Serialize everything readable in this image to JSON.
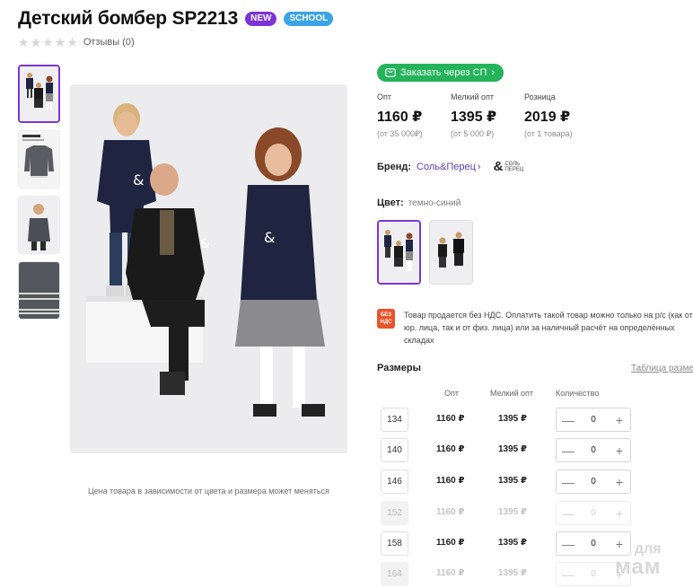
{
  "product": {
    "title": "Детский бомбер SP2213",
    "badges": [
      "NEW",
      "SCHOOL"
    ],
    "reviews": "Отзывы (0)"
  },
  "gallery": {
    "thumbs": [
      "group-photo",
      "bomber-label",
      "boy-photo",
      "sleeve-detail"
    ],
    "price_note": "Цена товара в зависимости от цвета и размера может меняться"
  },
  "order": {
    "button_label": "Заказать через СП",
    "button_color": "#24b35a"
  },
  "prices": {
    "opt": {
      "label": "Опт",
      "value": "1160 ₽",
      "cond": "(от 35 000₽)"
    },
    "small_opt": {
      "label": "Мелкий опт",
      "value": "1395 ₽",
      "cond": "(от 5 000 ₽)"
    },
    "retail": {
      "label": "Розница",
      "value": "2019 ₽",
      "cond": "(от 1 товара)"
    }
  },
  "brand": {
    "label": "Бренд:",
    "name": "Соль&Перец",
    "logo_top": "СОЛЬ",
    "logo_bottom": "ПЕРЕЦ"
  },
  "color": {
    "label": "Цвет:",
    "value": "темно-синий"
  },
  "vat": {
    "badge_top": "БЕЗ",
    "badge_bottom": "НДС",
    "text": "Товар продается без НДС. Оплатить такой товар можно только на р/с (как от юр. лица, так и от физ. лица) или за наличный расчёт на определённых складах"
  },
  "sizes": {
    "title": "Размеры",
    "table_link": "Таблица разме",
    "headers": {
      "opt": "Опт",
      "small_opt": "Мелкий опт",
      "quantity": "Количество"
    },
    "rows": [
      {
        "size": "134",
        "opt": "1160 ₽",
        "small": "1395 ₽",
        "qty": "0",
        "available": true
      },
      {
        "size": "140",
        "opt": "1160 ₽",
        "small": "1395 ₽",
        "qty": "0",
        "available": true
      },
      {
        "size": "146",
        "opt": "1160 ₽",
        "small": "1395 ₽",
        "qty": "0",
        "available": true
      },
      {
        "size": "152",
        "opt": "1160 ₽",
        "small": "1395 ₽",
        "qty": "0",
        "available": false
      },
      {
        "size": "158",
        "opt": "1160 ₽",
        "small": "1395 ₽",
        "qty": "0",
        "available": true
      },
      {
        "size": "164",
        "opt": "1160 ₽",
        "small": "1395 ₽",
        "qty": "0",
        "available": false
      }
    ],
    "minus": "—",
    "plus": "+"
  },
  "watermark": {
    "line1": "для",
    "line2": "мам"
  },
  "colors": {
    "accent": "#7b34d8",
    "new_badge": "#7b34d8",
    "school_badge": "#3aa4e6",
    "vat_badge": "#e8542c"
  }
}
